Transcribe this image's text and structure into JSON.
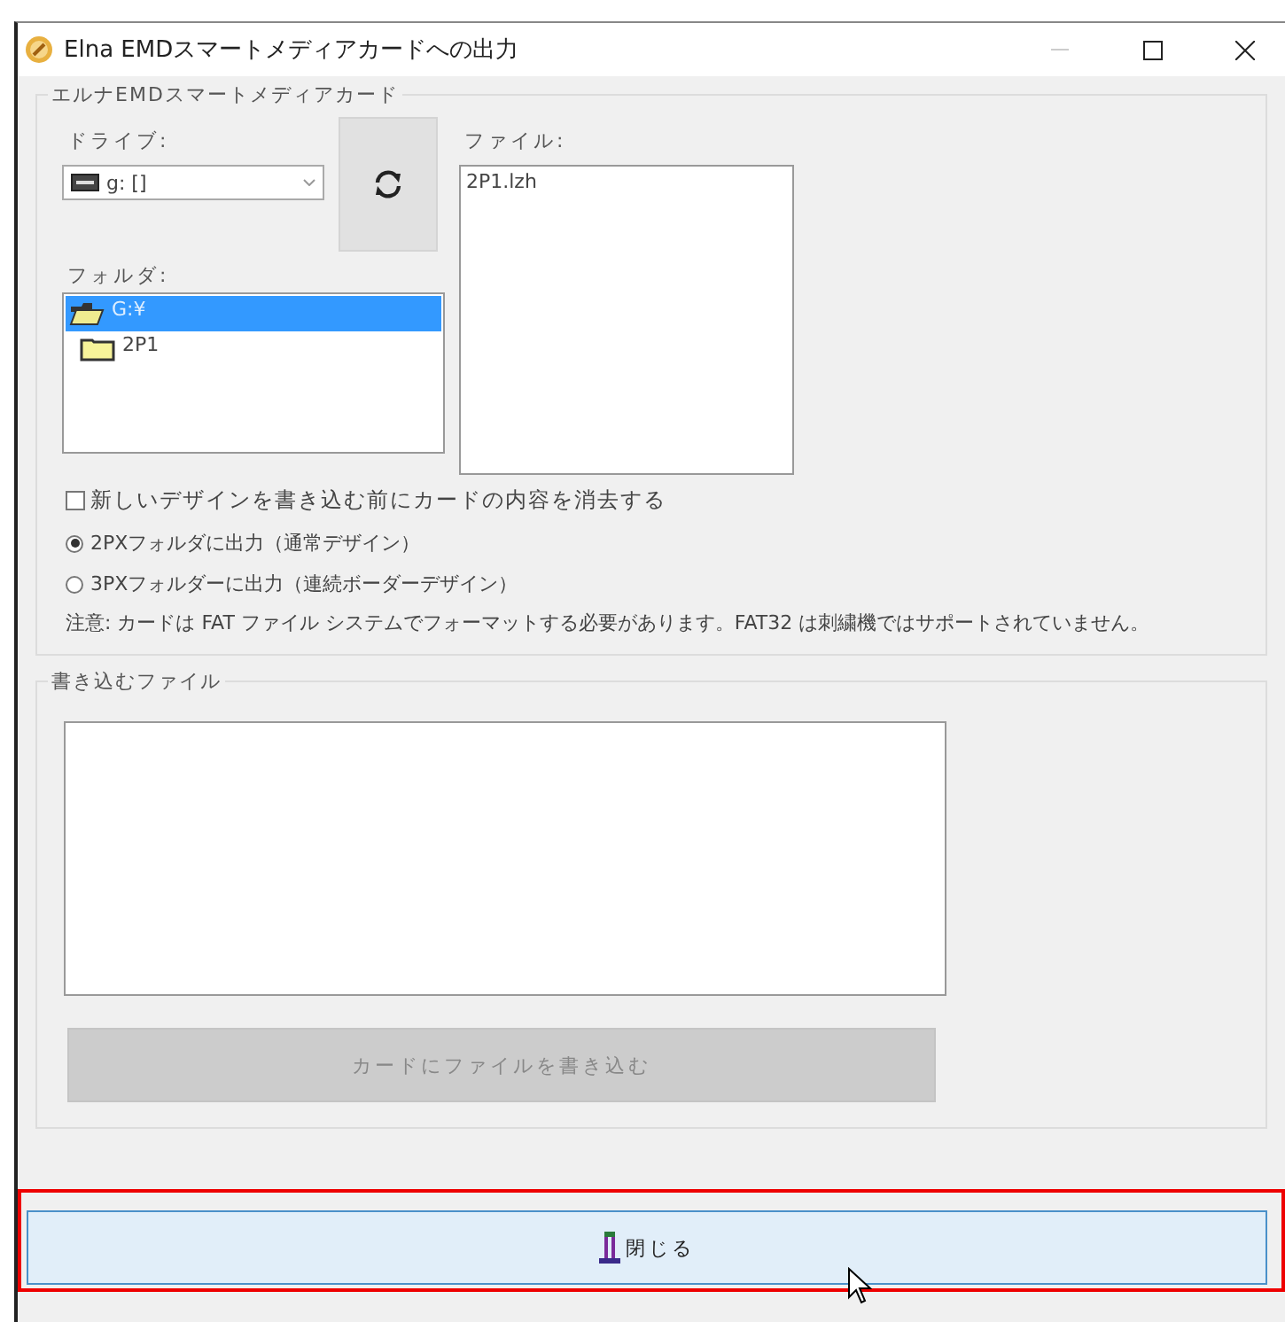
{
  "window": {
    "title": "Elna EMDスマートメディアカードへの出力"
  },
  "card_group": {
    "title": "エルナEMDスマートメディアカード",
    "drive": {
      "label": "ドライブ:",
      "value": "g: []"
    },
    "files": {
      "label": "ファイル:",
      "items": [
        "2P1.lzh"
      ]
    },
    "folders": {
      "label": "フォルダ:",
      "items": [
        {
          "name": "G:¥",
          "selected": true,
          "expanded": true,
          "children": [
            {
              "name": "2P1",
              "selected": false,
              "expanded": false
            }
          ]
        }
      ]
    },
    "erase_checkbox": {
      "label": "新しいデザインを書き込む前にカードの内容を消去する",
      "checked": false
    },
    "output_options": [
      {
        "label": "2PXフォルダに出力（通常デザイン）",
        "selected": true
      },
      {
        "label": "3PXフォルダーに出力（連続ボーダーデザイン）",
        "selected": false
      }
    ],
    "note": "注意: カードは FAT ファイル システムでフォーマットする必要があります。FAT32 は刺繍機ではサポートされていません。"
  },
  "write_group": {
    "title": "書き込むファイル",
    "write_button": {
      "label": "カードにファイルを書き込む",
      "disabled": true
    }
  },
  "close_button": {
    "label": "閉じる"
  }
}
